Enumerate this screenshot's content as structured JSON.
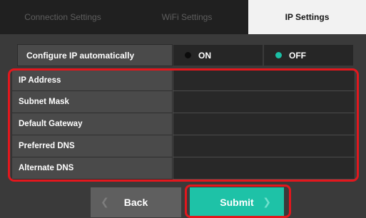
{
  "tabs": [
    {
      "label": "Connection Settings",
      "active": false
    },
    {
      "label": "WiFi Settings",
      "active": false
    },
    {
      "label": "IP Settings",
      "active": true
    }
  ],
  "auto_ip": {
    "label": "Configure IP automatically",
    "on_label": "ON",
    "off_label": "OFF",
    "selected": "OFF"
  },
  "fields": [
    {
      "label": "IP Address",
      "value": ""
    },
    {
      "label": "Subnet Mask",
      "value": ""
    },
    {
      "label": "Default Gateway",
      "value": ""
    },
    {
      "label": "Preferred DNS",
      "value": ""
    },
    {
      "label": "Alternate DNS",
      "value": ""
    }
  ],
  "buttons": {
    "back_label": "Back",
    "submit_label": "Submit",
    "back_icon": "chevron-left-icon",
    "submit_icon": "chevron-right-icon"
  },
  "colors": {
    "accent": "#1ec2a7",
    "highlight": "#e3171d",
    "active_tab": "#f2f2f2"
  }
}
